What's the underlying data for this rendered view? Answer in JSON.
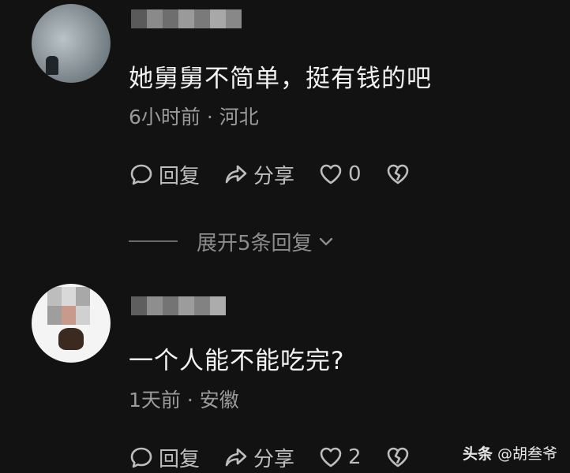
{
  "comments": [
    {
      "text": "她舅舅不简单，挺有钱的吧",
      "meta": "6小时前 · 河北",
      "actions": {
        "reply_label": "回复",
        "share_label": "分享",
        "like_count": "0"
      },
      "expand_label": "展开5条回复"
    },
    {
      "text": "一个人能不能吃完?",
      "meta": "1天前 · 安徽",
      "actions": {
        "reply_label": "回复",
        "share_label": "分享",
        "like_count": "2"
      }
    }
  ],
  "watermark": {
    "brand": "头条",
    "handle": "@胡叁爷"
  },
  "icons": {
    "reply": "comment-bubble-icon",
    "share": "share-arrow-icon",
    "like": "heart-icon",
    "dislike": "broken-heart-icon",
    "expand": "chevron-down-icon"
  },
  "colors": {
    "background": "#121212",
    "text_primary": "#f2f2f2",
    "text_secondary": "#9b9b9b",
    "action": "#bdbdbd"
  }
}
